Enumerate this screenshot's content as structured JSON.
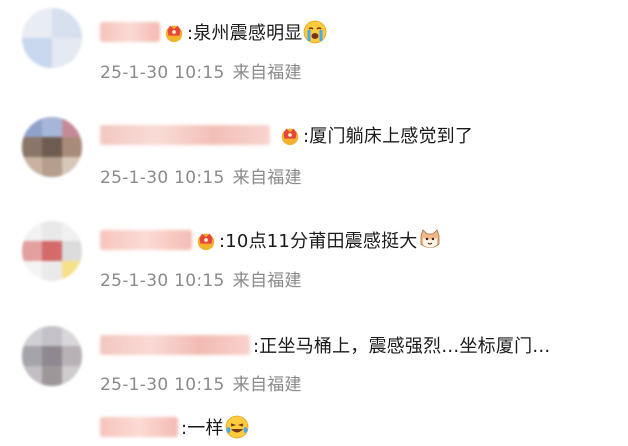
{
  "comments": [
    {
      "text": ":泉州震感明显",
      "emoji": "crying-face-icon",
      "timestamp": "25-1-30 10:15",
      "location": "来自福建"
    },
    {
      "text": ":厦门躺床上感觉到了",
      "emoji": "",
      "timestamp": "25-1-30 10:15",
      "location": "来自福建"
    },
    {
      "text": ":10点11分莆田震感挺大",
      "emoji": "cat-face-icon",
      "timestamp": "25-1-30 10:15",
      "location": "来自福建"
    },
    {
      "text": ":正坐马桶上，震感强烈…坐标厦门…",
      "emoji": "",
      "timestamp": "25-1-30 10:15",
      "location": "来自福建"
    },
    {
      "text": ":一样",
      "emoji": "laughing-tears-face-icon",
      "timestamp": "",
      "location": ""
    }
  ],
  "colors": {
    "text": "#1a1a1a",
    "meta": "#8a8a8a",
    "username_blur": "#f5b8b0",
    "badge_gold": "#f2b22c",
    "badge_red": "#e8453c"
  }
}
